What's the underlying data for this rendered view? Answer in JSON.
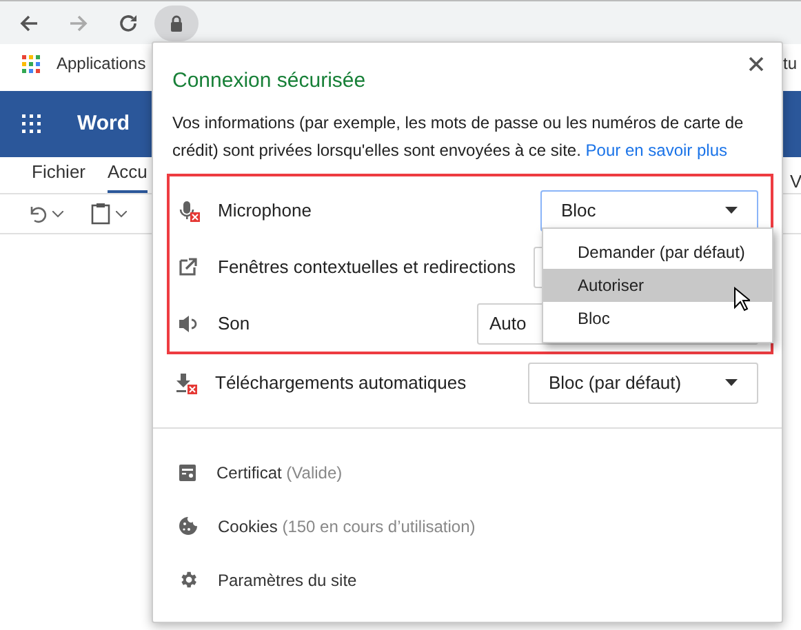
{
  "browser": {
    "bookmarks": [
      {
        "label": "Applications"
      },
      {
        "label": "tu"
      }
    ]
  },
  "word": {
    "app_name": "Word",
    "ribbon_tabs": [
      {
        "label": "Fichier",
        "selected": false
      },
      {
        "label": "Accu",
        "selected": true
      }
    ],
    "edge_text": "V"
  },
  "popup": {
    "title": "Connexion sécurisée",
    "description": "Vos informations (par exemple, les mots de passe ou les numéros de carte de crédit) sont privées lorsqu'elles sont envoyées à ce site.",
    "link": "Pour en savoir plus",
    "permissions": [
      {
        "kind": "microphone",
        "label": "Microphone",
        "value": "Bloc",
        "blocked": true,
        "highlighted": true
      },
      {
        "kind": "popup",
        "label": "Fenêtres contextuelles et redirections",
        "blocked": false,
        "highlighted": true
      },
      {
        "kind": "sound",
        "label": "Son",
        "value": "Auto",
        "blocked": false,
        "highlighted": true
      },
      {
        "kind": "download",
        "label": "Téléchargements automatiques",
        "value": "Bloc (par défaut)",
        "blocked": true,
        "highlighted": false
      }
    ],
    "dropdown": {
      "options": [
        {
          "label": "Demander (par défaut)",
          "hovered": false
        },
        {
          "label": "Autoriser",
          "hovered": true
        },
        {
          "label": "Bloc",
          "hovered": false
        }
      ]
    },
    "links": [
      {
        "kind": "certificate",
        "label": "Certificat",
        "detail": "(Valide)"
      },
      {
        "kind": "cookie",
        "label": "Cookies",
        "detail": "(150 en cours d’utilisation)"
      },
      {
        "kind": "settings",
        "label": "Paramètres du site"
      }
    ]
  }
}
